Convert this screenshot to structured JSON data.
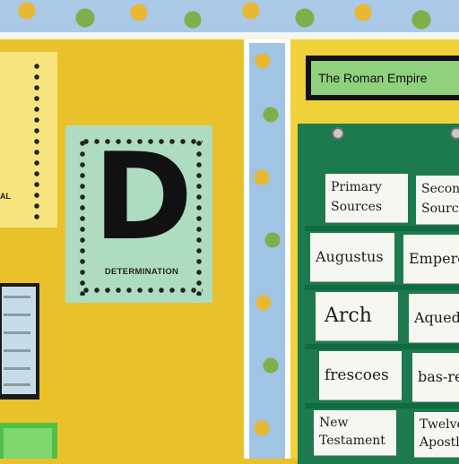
{
  "banner": {
    "title": "The Roman Empire"
  },
  "left_card": {
    "partial_label": "AL"
  },
  "letter_card": {
    "letter": "D",
    "word": "DETERMINATION"
  },
  "vocab_cards": [
    {
      "text": "Primary Sources"
    },
    {
      "text": "Secondary Sources"
    },
    {
      "text": "Augustus"
    },
    {
      "text": "Emperor"
    },
    {
      "text": "Arch"
    },
    {
      "text": "Aqueduct"
    },
    {
      "text": "frescoes"
    },
    {
      "text": "bas-relief"
    },
    {
      "text": "New Testament"
    },
    {
      "text": "Twelve Apostles"
    }
  ],
  "colors": {
    "wall_yellow": "#e9c12a",
    "pocket_chart_green": "#1c7a4e",
    "title_green": "#8fd17c",
    "letter_card_mint": "#aedcc1"
  }
}
